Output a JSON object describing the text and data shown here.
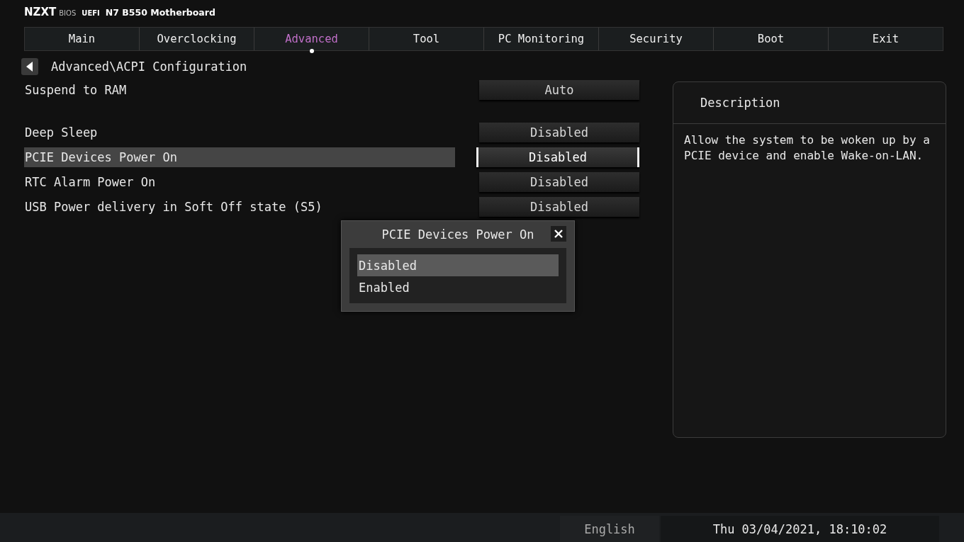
{
  "header": {
    "brand": "NZXT",
    "brand_sub": "BIOS",
    "firmware": "UEFI",
    "board": "N7 B550 Motherboard"
  },
  "tabs": [
    {
      "label": "Main",
      "selected": false
    },
    {
      "label": "Overclocking",
      "selected": false
    },
    {
      "label": "Advanced",
      "selected": true
    },
    {
      "label": "Tool",
      "selected": false
    },
    {
      "label": "PC Monitoring",
      "selected": false
    },
    {
      "label": "Security",
      "selected": false
    },
    {
      "label": "Boot",
      "selected": false
    },
    {
      "label": "Exit",
      "selected": false
    }
  ],
  "breadcrumb": "Advanced\\ACPI Configuration",
  "setting_groups": [
    [
      {
        "label": "Suspend to RAM",
        "value": "Auto",
        "selected": false
      }
    ],
    [
      {
        "label": "Deep Sleep",
        "value": "Disabled",
        "selected": false
      },
      {
        "label": "PCIE Devices Power On",
        "value": "Disabled",
        "selected": true
      },
      {
        "label": "RTC Alarm Power On",
        "value": "Disabled",
        "selected": false
      },
      {
        "label": "USB Power delivery in Soft Off state (S5)",
        "value": "Disabled",
        "selected": false
      }
    ]
  ],
  "popup": {
    "title": "PCIE Devices Power On",
    "options": [
      {
        "label": "Disabled",
        "selected": true
      },
      {
        "label": "Enabled",
        "selected": false
      }
    ]
  },
  "description": {
    "title": "Description",
    "text": "Allow the system to be woken up by a PCIE device and enable Wake-on-LAN."
  },
  "status_bar": {
    "language": "English",
    "datetime": "Thu 03/04/2021, 18:10:02"
  }
}
